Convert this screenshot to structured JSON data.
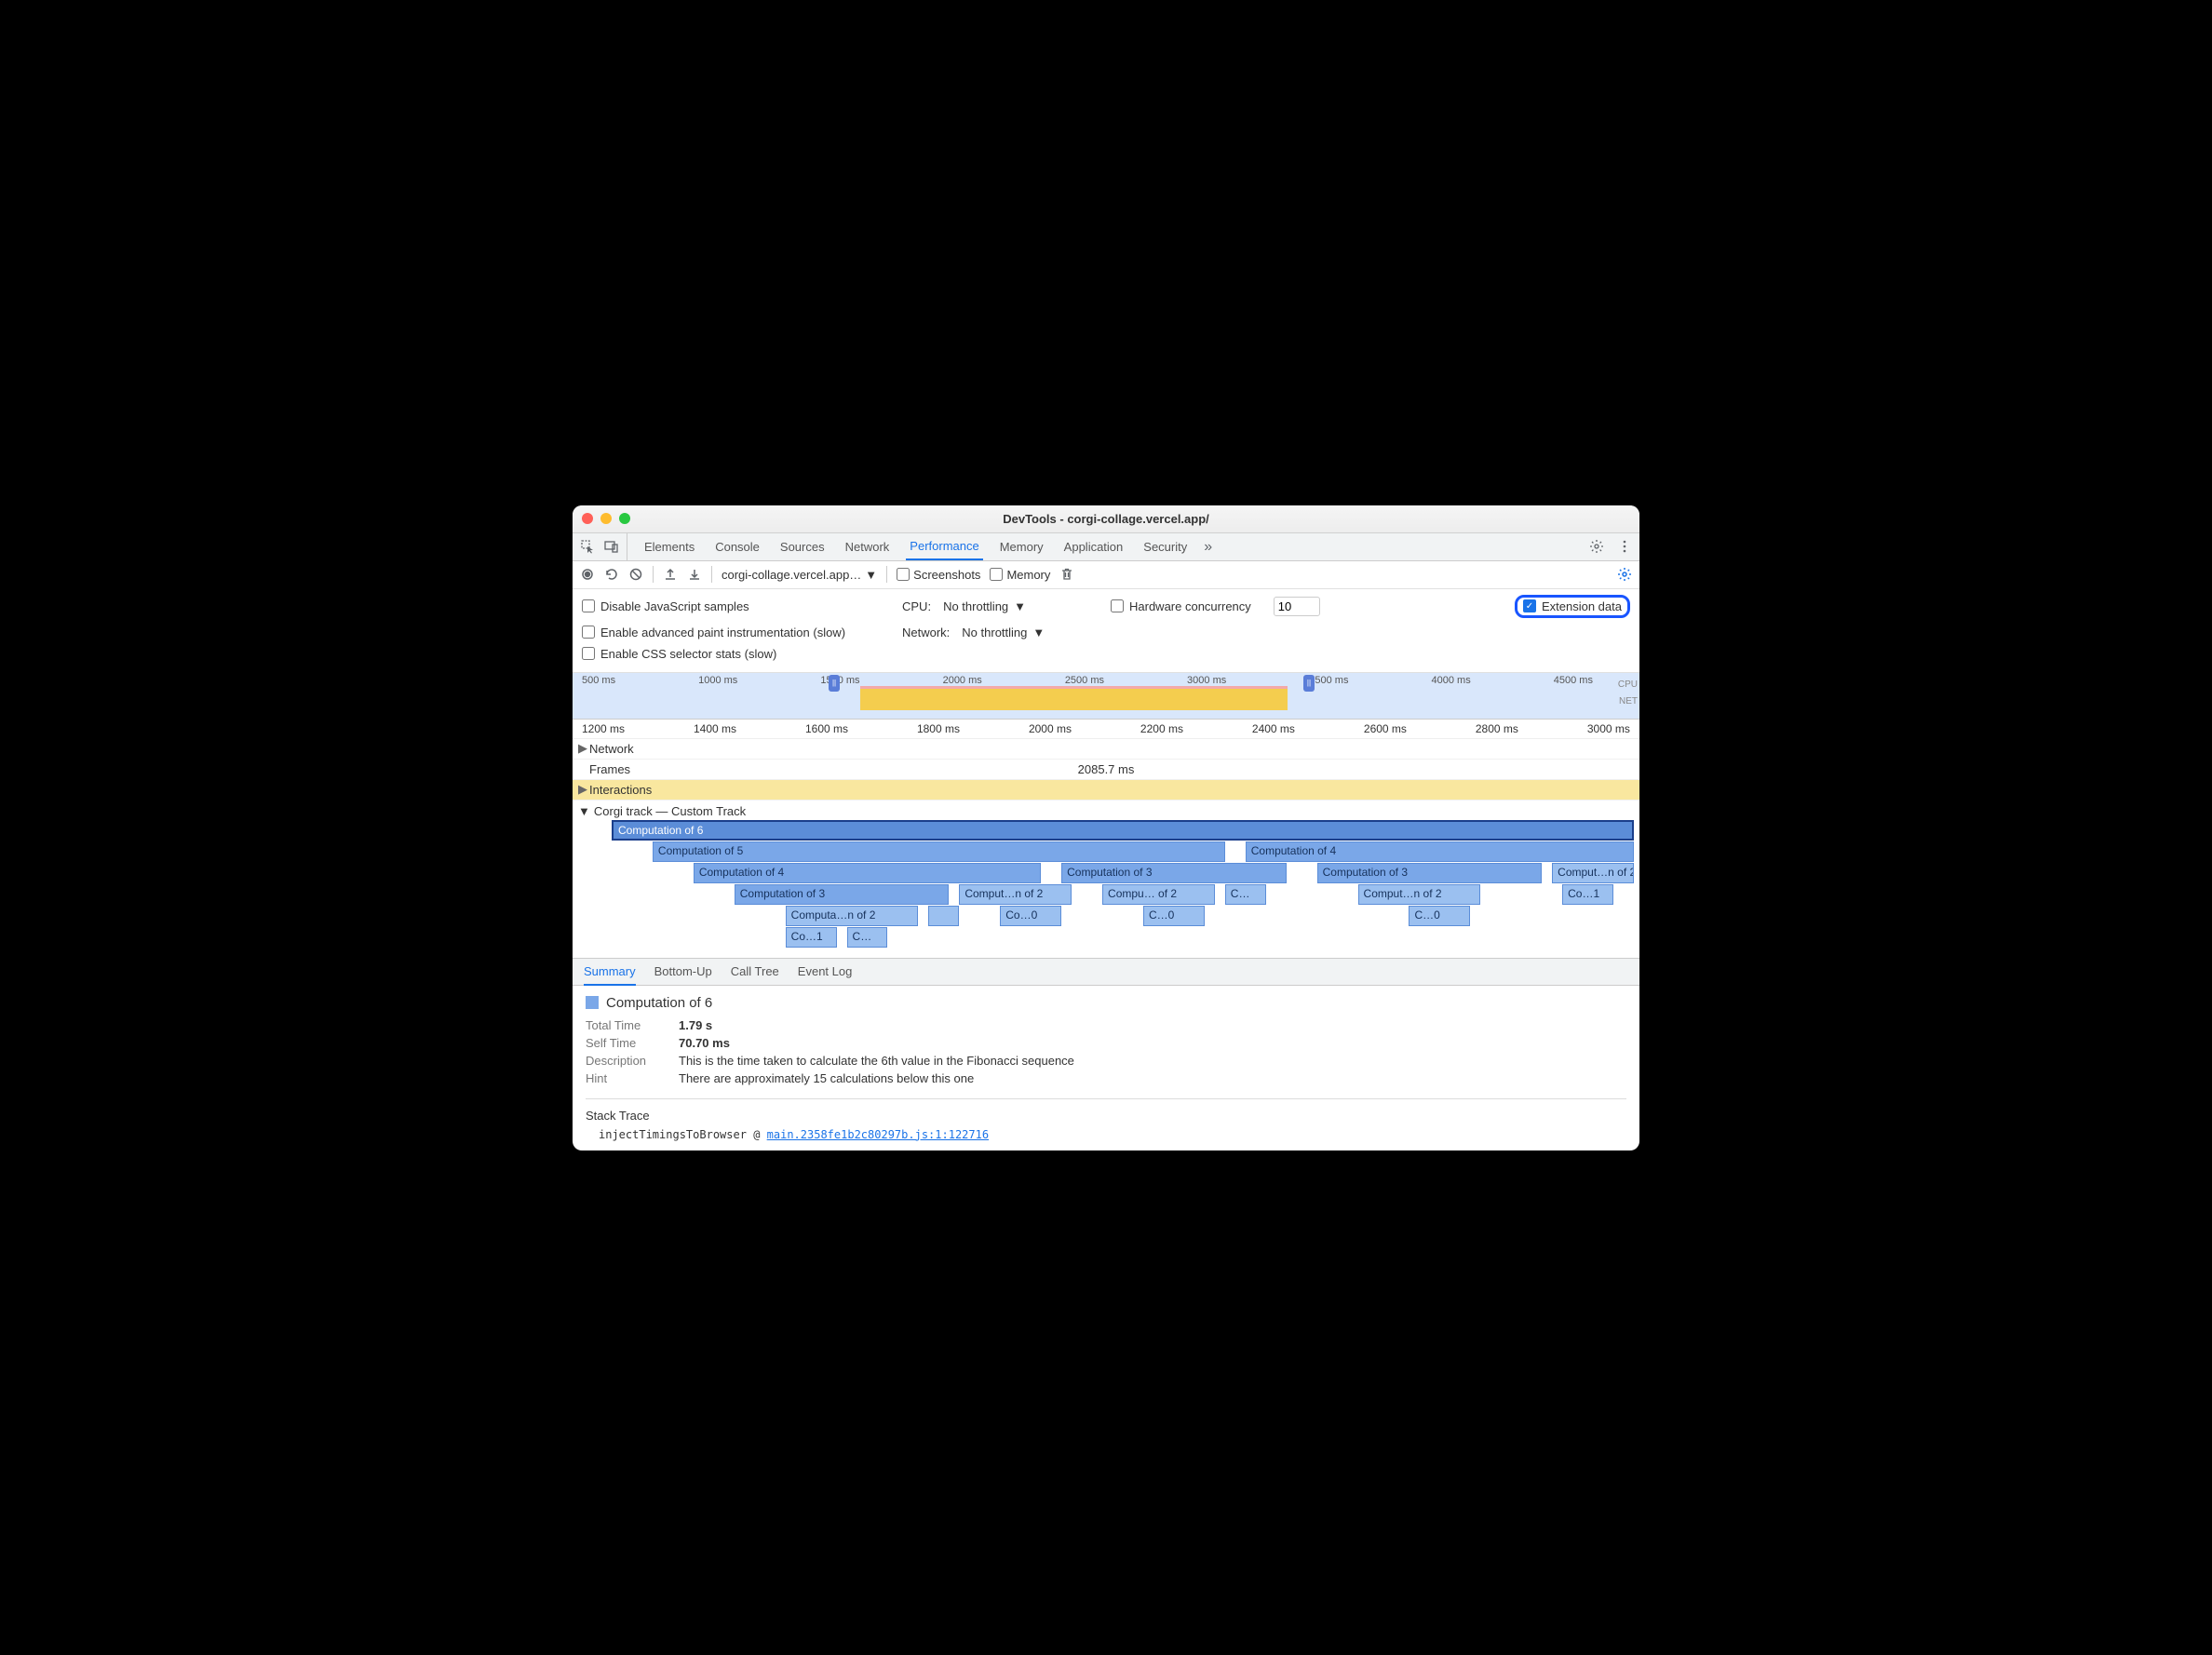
{
  "window_title": "DevTools - corgi-collage.vercel.app/",
  "tabs": [
    "Elements",
    "Console",
    "Sources",
    "Network",
    "Performance",
    "Memory",
    "Application",
    "Security"
  ],
  "active_tab": "Performance",
  "toolbar": {
    "url": "corgi-collage.vercel.app…",
    "screenshots": "Screenshots",
    "memory": "Memory"
  },
  "settings": {
    "disable_js": "Disable JavaScript samples",
    "cpu_label": "CPU:",
    "cpu_value": "No throttling",
    "hw_label": "Hardware concurrency",
    "hw_value": "10",
    "ext_data": "Extension data",
    "paint": "Enable advanced paint instrumentation (slow)",
    "net_label": "Network:",
    "net_value": "No throttling",
    "css_stats": "Enable CSS selector stats (slow)"
  },
  "overview_ticks": [
    "500 ms",
    "1000 ms",
    "1500 ms",
    "2000 ms",
    "2500 ms",
    "3000 ms",
    "3500 ms",
    "4000 ms",
    "4500 ms"
  ],
  "overview_labels": {
    "cpu": "CPU",
    "net": "NET"
  },
  "ruler_ticks": [
    "1200 ms",
    "1400 ms",
    "1600 ms",
    "1800 ms",
    "2000 ms",
    "2200 ms",
    "2400 ms",
    "2600 ms",
    "2800 ms",
    "3000 ms"
  ],
  "tracks": {
    "network": "Network",
    "frames": "Frames",
    "frames_time": "2085.7 ms",
    "interactions": "Interactions",
    "custom": "Corgi track — Custom Track"
  },
  "bars": {
    "r0": "Computation of 6",
    "r1a": "Computation of 5",
    "r1b": "Computation of 4",
    "r2a": "Computation of 4",
    "r2b": "Computation of 3",
    "r2c": "Computation of 3",
    "r2d": "Comput…n of 2",
    "r3a": "Computation of 3",
    "r3b": "Comput…n of 2",
    "r3c": "Compu… of 2",
    "r3d": "C…",
    "r3e": "Comput…n of 2",
    "r3f": "Co…1",
    "r4a": "Computa…n of 2",
    "r4c": "Co…0",
    "r4d": "C…0",
    "r4e": "C…0",
    "r5a": "Co…1",
    "r5b": "C…"
  },
  "btabs": [
    "Summary",
    "Bottom-Up",
    "Call Tree",
    "Event Log"
  ],
  "summary": {
    "title": "Computation of 6",
    "total_k": "Total Time",
    "total_v": "1.79 s",
    "self_k": "Self Time",
    "self_v": "70.70 ms",
    "desc_k": "Description",
    "desc_v": "This is the time taken to calculate the 6th value in the Fibonacci sequence",
    "hint_k": "Hint",
    "hint_v": "There are approximately 15 calculations below this one",
    "stack_title": "Stack Trace",
    "stack_fn": "injectTimingsToBrowser",
    "stack_at": "@",
    "stack_link": "main.2358fe1b2c80297b.js:1:122716"
  }
}
